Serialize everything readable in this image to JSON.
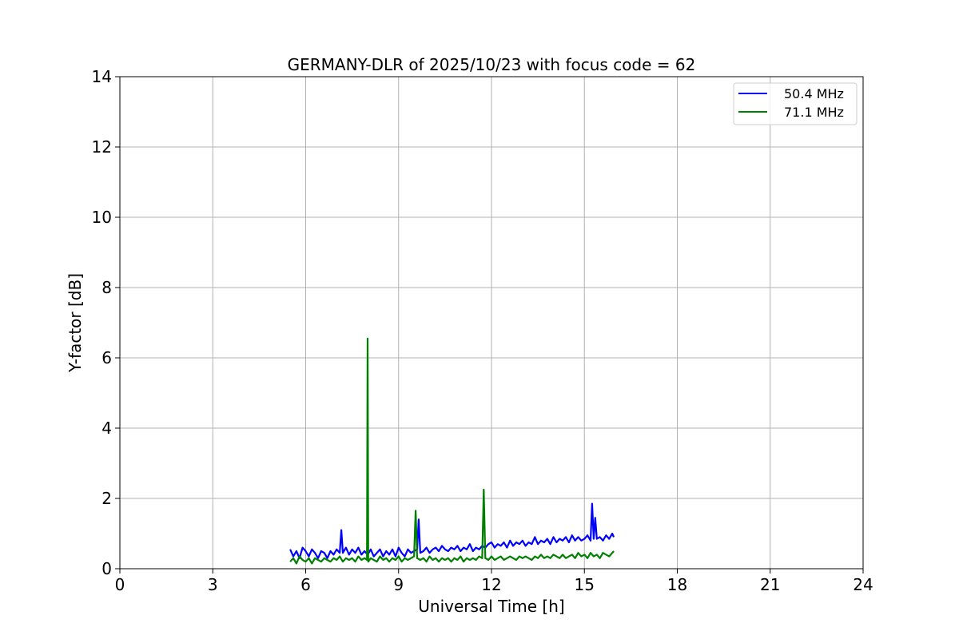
{
  "chart_data": {
    "type": "line",
    "title": "GERMANY-DLR of 2025/10/23 with focus code = 62",
    "xlabel": "Universal Time [h]",
    "ylabel": "Y-factor [dB]",
    "xlim": [
      0,
      24
    ],
    "ylim": [
      0,
      14
    ],
    "xticks": [
      0,
      3,
      6,
      9,
      12,
      15,
      18,
      21,
      24
    ],
    "yticks": [
      0,
      2,
      4,
      6,
      8,
      10,
      12,
      14
    ],
    "grid": true,
    "legend_position": "top-right",
    "series": [
      {
        "name": "50.4 MHz",
        "color": "#0000ff",
        "x": [
          5.5,
          5.6,
          5.7,
          5.8,
          5.9,
          6.0,
          6.1,
          6.2,
          6.3,
          6.4,
          6.5,
          6.6,
          6.7,
          6.8,
          6.9,
          7.0,
          7.1,
          7.15,
          7.2,
          7.3,
          7.4,
          7.5,
          7.6,
          7.7,
          7.8,
          7.9,
          8.0,
          8.1,
          8.2,
          8.3,
          8.4,
          8.5,
          8.6,
          8.7,
          8.8,
          8.9,
          9.0,
          9.1,
          9.2,
          9.3,
          9.4,
          9.5,
          9.6,
          9.65,
          9.7,
          9.8,
          9.9,
          10.0,
          10.1,
          10.2,
          10.3,
          10.4,
          10.5,
          10.6,
          10.7,
          10.8,
          10.9,
          11.0,
          11.1,
          11.2,
          11.3,
          11.4,
          11.5,
          11.6,
          11.7,
          11.8,
          11.9,
          12.0,
          12.1,
          12.2,
          12.3,
          12.4,
          12.5,
          12.6,
          12.7,
          12.8,
          12.9,
          13.0,
          13.1,
          13.2,
          13.3,
          13.4,
          13.5,
          13.6,
          13.7,
          13.8,
          13.9,
          14.0,
          14.1,
          14.2,
          14.3,
          14.4,
          14.5,
          14.6,
          14.7,
          14.8,
          14.9,
          15.0,
          15.1,
          15.2,
          15.25,
          15.3,
          15.35,
          15.4,
          15.5,
          15.6,
          15.7,
          15.8,
          15.9,
          15.95
        ],
        "y": [
          0.55,
          0.35,
          0.5,
          0.3,
          0.6,
          0.5,
          0.35,
          0.55,
          0.45,
          0.3,
          0.5,
          0.45,
          0.3,
          0.5,
          0.4,
          0.55,
          0.45,
          1.1,
          0.45,
          0.6,
          0.4,
          0.55,
          0.45,
          0.6,
          0.4,
          0.5,
          0.4,
          0.55,
          0.35,
          0.45,
          0.55,
          0.35,
          0.5,
          0.4,
          0.55,
          0.35,
          0.6,
          0.45,
          0.35,
          0.55,
          0.45,
          0.5,
          0.55,
          1.4,
          0.45,
          0.5,
          0.6,
          0.45,
          0.55,
          0.6,
          0.5,
          0.65,
          0.55,
          0.5,
          0.6,
          0.55,
          0.65,
          0.5,
          0.6,
          0.55,
          0.7,
          0.5,
          0.6,
          0.55,
          0.65,
          0.6,
          0.7,
          0.75,
          0.6,
          0.7,
          0.65,
          0.75,
          0.6,
          0.8,
          0.65,
          0.75,
          0.7,
          0.8,
          0.65,
          0.75,
          0.7,
          0.9,
          0.7,
          0.8,
          0.75,
          0.85,
          0.7,
          0.9,
          0.75,
          0.85,
          0.8,
          0.9,
          0.75,
          0.95,
          0.8,
          0.9,
          0.8,
          0.85,
          0.95,
          0.8,
          1.85,
          0.85,
          1.45,
          0.85,
          0.9,
          0.8,
          0.95,
          0.85,
          1.0,
          0.9
        ]
      },
      {
        "name": "71.1 MHz",
        "color": "#008000",
        "x": [
          5.5,
          5.6,
          5.7,
          5.8,
          5.9,
          6.0,
          6.1,
          6.2,
          6.3,
          6.4,
          6.5,
          6.6,
          6.7,
          6.8,
          6.9,
          7.0,
          7.1,
          7.2,
          7.3,
          7.4,
          7.5,
          7.6,
          7.7,
          7.8,
          7.9,
          7.98,
          8.0,
          8.02,
          8.1,
          8.2,
          8.3,
          8.4,
          8.5,
          8.6,
          8.7,
          8.8,
          8.9,
          9.0,
          9.1,
          9.2,
          9.3,
          9.4,
          9.5,
          9.55,
          9.6,
          9.7,
          9.8,
          9.9,
          10.0,
          10.1,
          10.2,
          10.3,
          10.4,
          10.5,
          10.6,
          10.7,
          10.8,
          10.9,
          11.0,
          11.1,
          11.2,
          11.3,
          11.4,
          11.5,
          11.6,
          11.7,
          11.75,
          11.8,
          11.9,
          12.0,
          12.1,
          12.2,
          12.3,
          12.4,
          12.5,
          12.6,
          12.7,
          12.8,
          12.9,
          13.0,
          13.1,
          13.2,
          13.3,
          13.4,
          13.5,
          13.6,
          13.7,
          13.8,
          13.9,
          14.0,
          14.1,
          14.2,
          14.3,
          14.4,
          14.5,
          14.6,
          14.7,
          14.8,
          14.9,
          15.0,
          15.1,
          15.2,
          15.3,
          15.4,
          15.5,
          15.6,
          15.7,
          15.8,
          15.9,
          15.95
        ],
        "y": [
          0.2,
          0.3,
          0.15,
          0.35,
          0.25,
          0.2,
          0.3,
          0.15,
          0.3,
          0.25,
          0.2,
          0.3,
          0.25,
          0.2,
          0.3,
          0.25,
          0.35,
          0.2,
          0.3,
          0.25,
          0.3,
          0.2,
          0.35,
          0.25,
          0.3,
          0.25,
          6.55,
          0.2,
          0.3,
          0.25,
          0.2,
          0.35,
          0.25,
          0.3,
          0.2,
          0.3,
          0.25,
          0.35,
          0.2,
          0.3,
          0.25,
          0.3,
          0.35,
          1.65,
          0.3,
          0.25,
          0.3,
          0.2,
          0.35,
          0.25,
          0.3,
          0.2,
          0.3,
          0.25,
          0.3,
          0.2,
          0.3,
          0.25,
          0.35,
          0.2,
          0.3,
          0.25,
          0.3,
          0.25,
          0.35,
          0.3,
          2.25,
          0.3,
          0.25,
          0.35,
          0.25,
          0.3,
          0.35,
          0.25,
          0.3,
          0.35,
          0.3,
          0.25,
          0.35,
          0.3,
          0.35,
          0.3,
          0.25,
          0.35,
          0.3,
          0.4,
          0.3,
          0.35,
          0.3,
          0.4,
          0.35,
          0.3,
          0.4,
          0.3,
          0.35,
          0.4,
          0.3,
          0.45,
          0.35,
          0.4,
          0.3,
          0.45,
          0.35,
          0.4,
          0.3,
          0.45,
          0.4,
          0.35,
          0.45,
          0.5
        ]
      }
    ]
  }
}
